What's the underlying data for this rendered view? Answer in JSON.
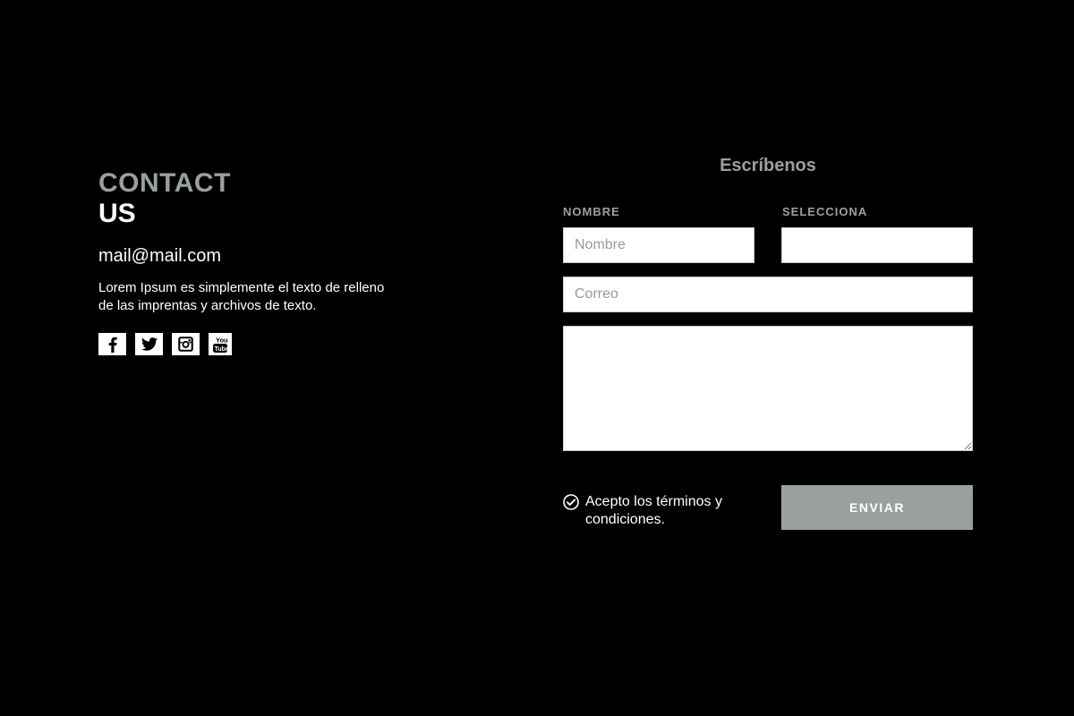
{
  "contact": {
    "heading_line1": "CONTACT",
    "heading_line2": "US",
    "email": "mail@mail.com",
    "description": "Lorem Ipsum es simplemente el texto de relleno de las imprentas y archivos de texto.",
    "social": [
      {
        "icon": "facebook-icon"
      },
      {
        "icon": "twitter-icon"
      },
      {
        "icon": "instagram-icon"
      },
      {
        "icon": "youtube-icon"
      }
    ]
  },
  "form": {
    "title": "Escríbenos",
    "name_label": "NOMBRE",
    "name_placeholder": "Nombre",
    "name_value": "",
    "select_label": "SELECCIONA",
    "select_value": "",
    "email_placeholder": "Correo",
    "email_value": "",
    "message_value": "",
    "terms_label": "Acepto los términos y condiciones.",
    "terms_checked": true,
    "submit_label": "ENVIAR"
  },
  "colors": {
    "background": "#000000",
    "accent_gray": "#9aa09d",
    "text": "#ffffff",
    "field_bg": "#ffffff"
  }
}
